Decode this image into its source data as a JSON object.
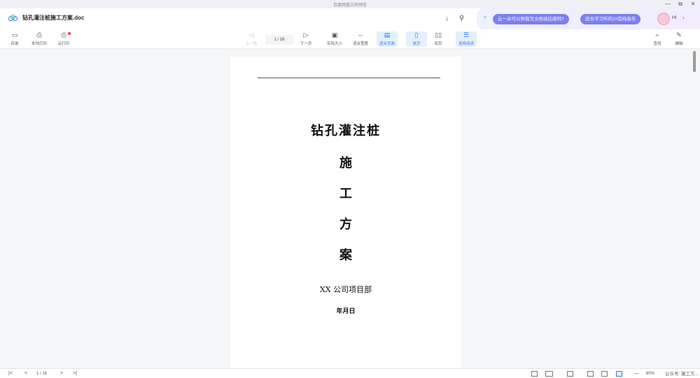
{
  "window": {
    "title": "百度网盘文档预览",
    "controls": [
      "—",
      "⧉",
      "✕"
    ]
  },
  "header": {
    "doc_title": "钻孔灌注桩施工方案.doc",
    "download_icon": "↓",
    "share_icon": "⚲"
  },
  "ai": {
    "close": "×",
    "suggestion1": "云一朵可以帮我写文档读后感吗?",
    "suggestion2": "适合学习听的10首纯音乐",
    "greeting": "Hi",
    "more": "›"
  },
  "toolbar": {
    "toc": "目录",
    "local_print": "本地打印",
    "cloud_print": "云打印",
    "prev": "上一页",
    "page_indicator": "1 / 16",
    "next": "下一页",
    "actual_size": "实际大小",
    "fit_width": "适合宽度",
    "fit_page": "适合页面",
    "single_page": "单页",
    "double_page": "双页",
    "continuous": "连续阅读",
    "search": "查找",
    "edit": "编辑"
  },
  "document": {
    "title_line1": "钻孔灌注桩",
    "title_line2": "施",
    "title_line3": "工",
    "title_line4": "方",
    "title_line5": "案",
    "company": "XX 公司项目部",
    "date": "年月日"
  },
  "bottom": {
    "first": "|<",
    "prev": "<",
    "page_indicator": "1 / 16",
    "next": ">",
    "last": ">|",
    "zoom": "80%",
    "zoom_out": "—",
    "zoom_in": "+",
    "watermark": "公众号: 施工方..."
  }
}
